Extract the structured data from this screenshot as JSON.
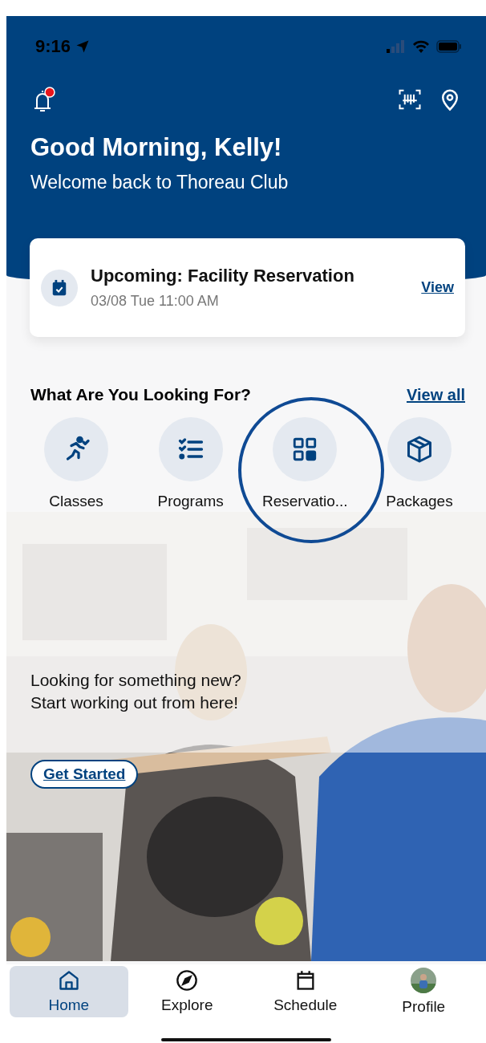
{
  "status_bar": {
    "time": "9:16"
  },
  "header": {
    "notification_badge": true,
    "greeting": "Good Morning, Kelly!",
    "subtitle": "Welcome back to Thoreau Club"
  },
  "upcoming": {
    "title": "Upcoming: Facility Reservation",
    "datetime": "03/08 Tue 11:00 AM",
    "action": "View"
  },
  "section": {
    "title": "What Are You Looking For?",
    "action": "View all"
  },
  "categories": [
    {
      "kind": "classes",
      "label": "Classes",
      "circled": false
    },
    {
      "kind": "programs",
      "label": "Programs",
      "circled": false
    },
    {
      "kind": "reservations",
      "label": "Reservatio...",
      "circled": true
    },
    {
      "kind": "packages",
      "label": "Packages",
      "circled": false
    }
  ],
  "promo": {
    "line1": "Looking for something new?",
    "line2": "Start working out from here!",
    "button": "Get Started"
  },
  "tab_bar": [
    {
      "kind": "home",
      "label": "Home",
      "selected": true
    },
    {
      "kind": "explore",
      "label": "Explore",
      "selected": false
    },
    {
      "kind": "schedule",
      "label": "Schedule",
      "selected": false
    },
    {
      "kind": "profile",
      "label": "Profile",
      "selected": false
    }
  ]
}
